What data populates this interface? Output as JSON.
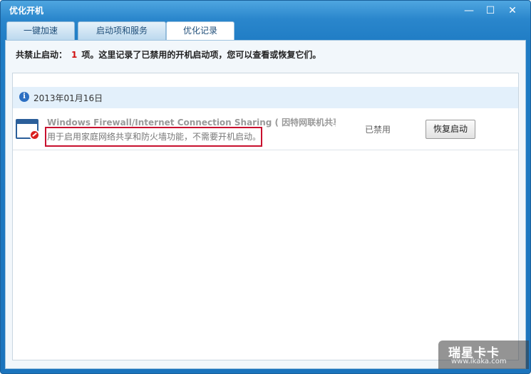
{
  "window": {
    "title": "优化开机",
    "minimize_glyph": "—",
    "maximize_glyph": "☐",
    "close_glyph": "✕"
  },
  "tabs": [
    {
      "label": "一键加速",
      "active": false
    },
    {
      "label": "启动项和服务",
      "active": false
    },
    {
      "label": "优化记录",
      "active": true
    }
  ],
  "summary": {
    "prefix": "共禁止启动：",
    "count": "1",
    "suffix": "项。这里记录了已禁用的开机启动项，您可以查看或恢复它们。"
  },
  "log": {
    "date": "2013年01月16日",
    "info_icon": "info-icon",
    "items": [
      {
        "icon": "blocked-app-icon",
        "name": "Windows Firewall/Internet Connection Sharing ( 因特网联机共享和防...",
        "description": "用于启用家庭网络共享和防火墙功能，不需要开机启动。",
        "status": "已禁用",
        "action_label": "恢复启动"
      }
    ]
  },
  "watermark": {
    "title": "瑞星卡卡",
    "url": "www.ikaka.com"
  },
  "colors": {
    "title_bar": "#2a86cc",
    "count_red": "#d01010",
    "highlight_box": "#c8102e",
    "date_row_bg": "#e3f0fb"
  }
}
